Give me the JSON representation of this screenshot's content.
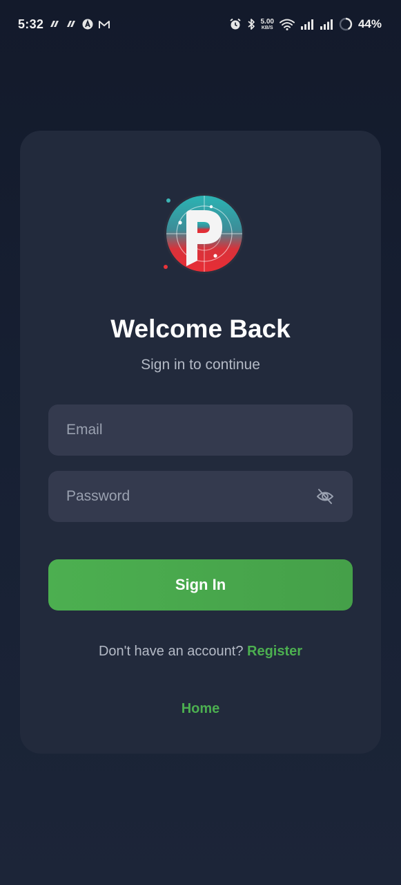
{
  "status_bar": {
    "time": "5:32",
    "net_speed_value": "5.00",
    "net_speed_unit": "KB/S",
    "battery_percent": "44%",
    "left_icons": [
      "notification-app-icon",
      "notification-app-icon",
      "notification-app-icon",
      "gmail-icon"
    ],
    "right_icons": [
      "alarm-icon",
      "bluetooth-icon",
      "wifi-icon",
      "signal-icon",
      "signal-icon",
      "battery-icon"
    ]
  },
  "login": {
    "logo_letter": "P",
    "title": "Welcome Back",
    "subtitle": "Sign in to continue",
    "email_placeholder": "Email",
    "email_value": "",
    "password_placeholder": "Password",
    "password_value": "",
    "password_toggle_icon": "eye-off-icon",
    "sign_in_label": "Sign In",
    "register_prompt": "Don't have an account? ",
    "register_link": "Register",
    "home_link": "Home"
  },
  "colors": {
    "background": "#151c2e",
    "card": "#222a3c",
    "input": "#343a4e",
    "accent_green": "#4caf50",
    "muted_text": "#b4bac6"
  }
}
